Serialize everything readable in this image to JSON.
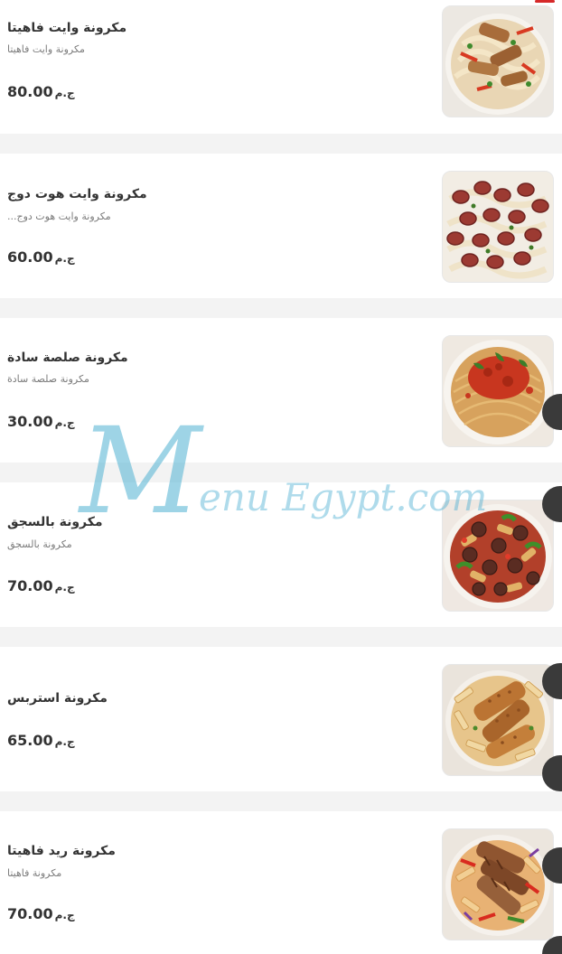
{
  "menu": {
    "items": [
      {
        "name": "مكرونة وايت فاهيتا",
        "description": "مكرونة وايت فاهيتا",
        "price": "80.00",
        "currency": "ج.م",
        "image": "white-fajita-pasta-image"
      },
      {
        "name": "مكرونة وايت هوت دوج",
        "description": "مكرونة وايت هوت دوج...",
        "price": "60.00",
        "currency": "ج.م",
        "image": "white-hotdog-pasta-image"
      },
      {
        "name": "مكرونة صلصة سادة",
        "description": "مكرونة صلصة سادة",
        "price": "30.00",
        "currency": "ج.م",
        "image": "plain-tomato-pasta-image"
      },
      {
        "name": "مكرونة بالسجق",
        "description": "مكرونة بالسجق",
        "price": "70.00",
        "currency": "ج.م",
        "image": "sausage-pasta-image"
      },
      {
        "name": "مكرونة استربس",
        "description": "",
        "price": "65.00",
        "currency": "ج.م",
        "image": "strips-pasta-image"
      },
      {
        "name": "مكرونة ريد فاهيتا",
        "description": "مكرونة فاهيتا",
        "price": "70.00",
        "currency": "ج.م",
        "image": "red-fajita-pasta-image"
      }
    ]
  },
  "watermark": {
    "initial": "M",
    "text": "enu Egypt.com"
  },
  "colors": {
    "background": "#f3f3f3",
    "card": "#ffffff",
    "title": "#333333",
    "description": "#7b7b7b",
    "accent": "#d62929",
    "watermark": "#4eb0d2"
  }
}
